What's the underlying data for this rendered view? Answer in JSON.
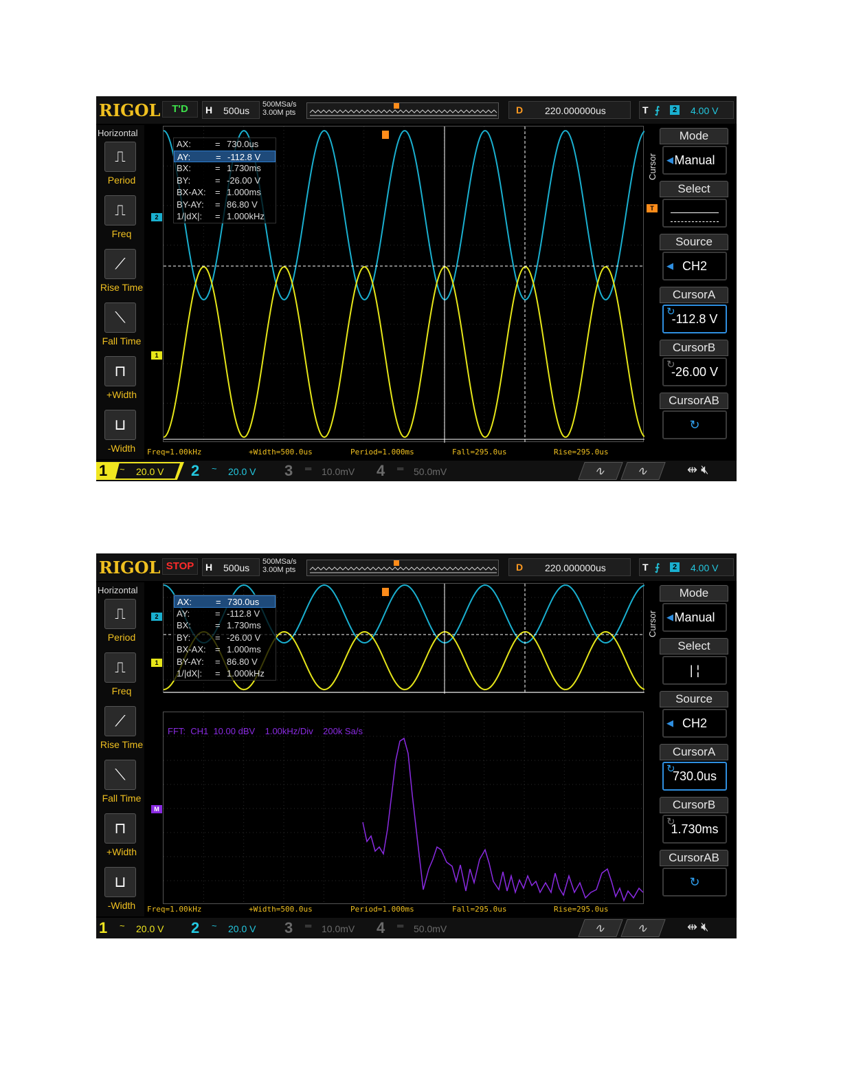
{
  "colors": {
    "ch1": "#e6e619",
    "ch2": "#1ab0d0",
    "math": "#8a2be2",
    "trigger": "#ff8c1a",
    "background": "#000000"
  },
  "screens": [
    {
      "logo": "RIGOL",
      "run_state": "T'D",
      "horizontal": {
        "label": "H",
        "value": "500us"
      },
      "sample_rate": "500MSa/s",
      "memory_depth": "3.00M pts",
      "delay": {
        "label": "D",
        "value": "220.000000us"
      },
      "trigger": {
        "label": "T",
        "edge_icon": "rising-edge-icon",
        "source": "2",
        "level": "4.00 V"
      },
      "left_menu": {
        "title": "Horizontal",
        "items": [
          {
            "label": "Period",
            "icon": "period-icon"
          },
          {
            "label": "Freq",
            "icon": "freq-icon"
          },
          {
            "label": "Rise Time",
            "icon": "rise-time-icon"
          },
          {
            "label": "Fall Time",
            "icon": "fall-time-icon"
          },
          {
            "label": "+Width",
            "icon": "pos-width-icon"
          },
          {
            "label": "-Width",
            "icon": "neg-width-icon"
          }
        ]
      },
      "cursor_readout": [
        {
          "key": "AX:",
          "value": "730.0us"
        },
        {
          "key": "AY:",
          "value": "-112.8 V",
          "selected": true
        },
        {
          "key": "BX:",
          "value": "1.730ms"
        },
        {
          "key": "BY:",
          "value": "-26.00 V"
        },
        {
          "key": "BX-AX:",
          "value": "1.000ms"
        },
        {
          "key": "BY-AY:",
          "value": "86.80 V"
        },
        {
          "key": "1/|dX|:",
          "value": "1.000kHz"
        }
      ],
      "right_menu": {
        "side_label": "Cursor",
        "items": [
          {
            "head": "Mode",
            "value": "Manual"
          },
          {
            "head": "Select",
            "value": ""
          },
          {
            "head": "Source",
            "value": "CH2"
          },
          {
            "head": "CursorA",
            "value": "-112.8 V"
          },
          {
            "head": "CursorB",
            "value": "-26.00 V"
          },
          {
            "head": "CursorAB",
            "value": ""
          }
        ]
      },
      "measurements": [
        "Freq=1.00kHz",
        "+Width=500.0us",
        "Period=1.000ms",
        "Fall=295.0us",
        "Rise=295.0us"
      ],
      "channels": [
        {
          "num": "1",
          "coupling": "~",
          "scale": "20.0 V"
        },
        {
          "num": "2",
          "coupling": "~",
          "scale": "20.0 V"
        },
        {
          "num": "3",
          "coupling": "═",
          "scale": "10.0mV"
        },
        {
          "num": "4",
          "coupling": "═",
          "scale": "50.0mV"
        }
      ]
    },
    {
      "logo": "RIGOL",
      "run_state": "STOP",
      "horizontal": {
        "label": "H",
        "value": "500us"
      },
      "sample_rate": "500MSa/s",
      "memory_depth": "3.00M pts",
      "delay": {
        "label": "D",
        "value": "220.000000us"
      },
      "trigger": {
        "label": "T",
        "edge_icon": "rising-edge-icon",
        "source": "2",
        "level": "4.00 V"
      },
      "left_menu": {
        "title": "Horizontal",
        "items": [
          {
            "label": "Period",
            "icon": "period-icon"
          },
          {
            "label": "Freq",
            "icon": "freq-icon"
          },
          {
            "label": "Rise Time",
            "icon": "rise-time-icon"
          },
          {
            "label": "Fall Time",
            "icon": "fall-time-icon"
          },
          {
            "label": "+Width",
            "icon": "pos-width-icon"
          },
          {
            "label": "-Width",
            "icon": "neg-width-icon"
          }
        ]
      },
      "cursor_readout": [
        {
          "key": "AX:",
          "value": "730.0us",
          "selected": true
        },
        {
          "key": "AY:",
          "value": "-112.8 V"
        },
        {
          "key": "BX:",
          "value": "1.730ms"
        },
        {
          "key": "BY:",
          "value": "-26.00 V"
        },
        {
          "key": "BX-AX:",
          "value": "1.000ms"
        },
        {
          "key": "BY-AY:",
          "value": "86.80 V"
        },
        {
          "key": "1/|dX|:",
          "value": "1.000kHz"
        }
      ],
      "fft_label": "FFT:  CH1  10.00 dBV    1.00kHz/Div    200k Sa/s",
      "right_menu": {
        "side_label": "Cursor",
        "items": [
          {
            "head": "Mode",
            "value": "Manual"
          },
          {
            "head": "Select",
            "value": "|   ¦"
          },
          {
            "head": "Source",
            "value": "CH2"
          },
          {
            "head": "CursorA",
            "value": "730.0us"
          },
          {
            "head": "CursorB",
            "value": "1.730ms"
          },
          {
            "head": "CursorAB",
            "value": ""
          }
        ]
      },
      "measurements": [
        "Freq=1.00kHz",
        "+Width=500.0us",
        "Period=1.000ms",
        "Fall=295.0us",
        "Rise=295.0us"
      ],
      "channels": [
        {
          "num": "1",
          "coupling": "~",
          "scale": "20.0 V"
        },
        {
          "num": "2",
          "coupling": "~",
          "scale": "20.0 V"
        },
        {
          "num": "3",
          "coupling": "═",
          "scale": "10.0mV"
        },
        {
          "num": "4",
          "coupling": "═",
          "scale": "50.0mV"
        }
      ]
    }
  ]
}
